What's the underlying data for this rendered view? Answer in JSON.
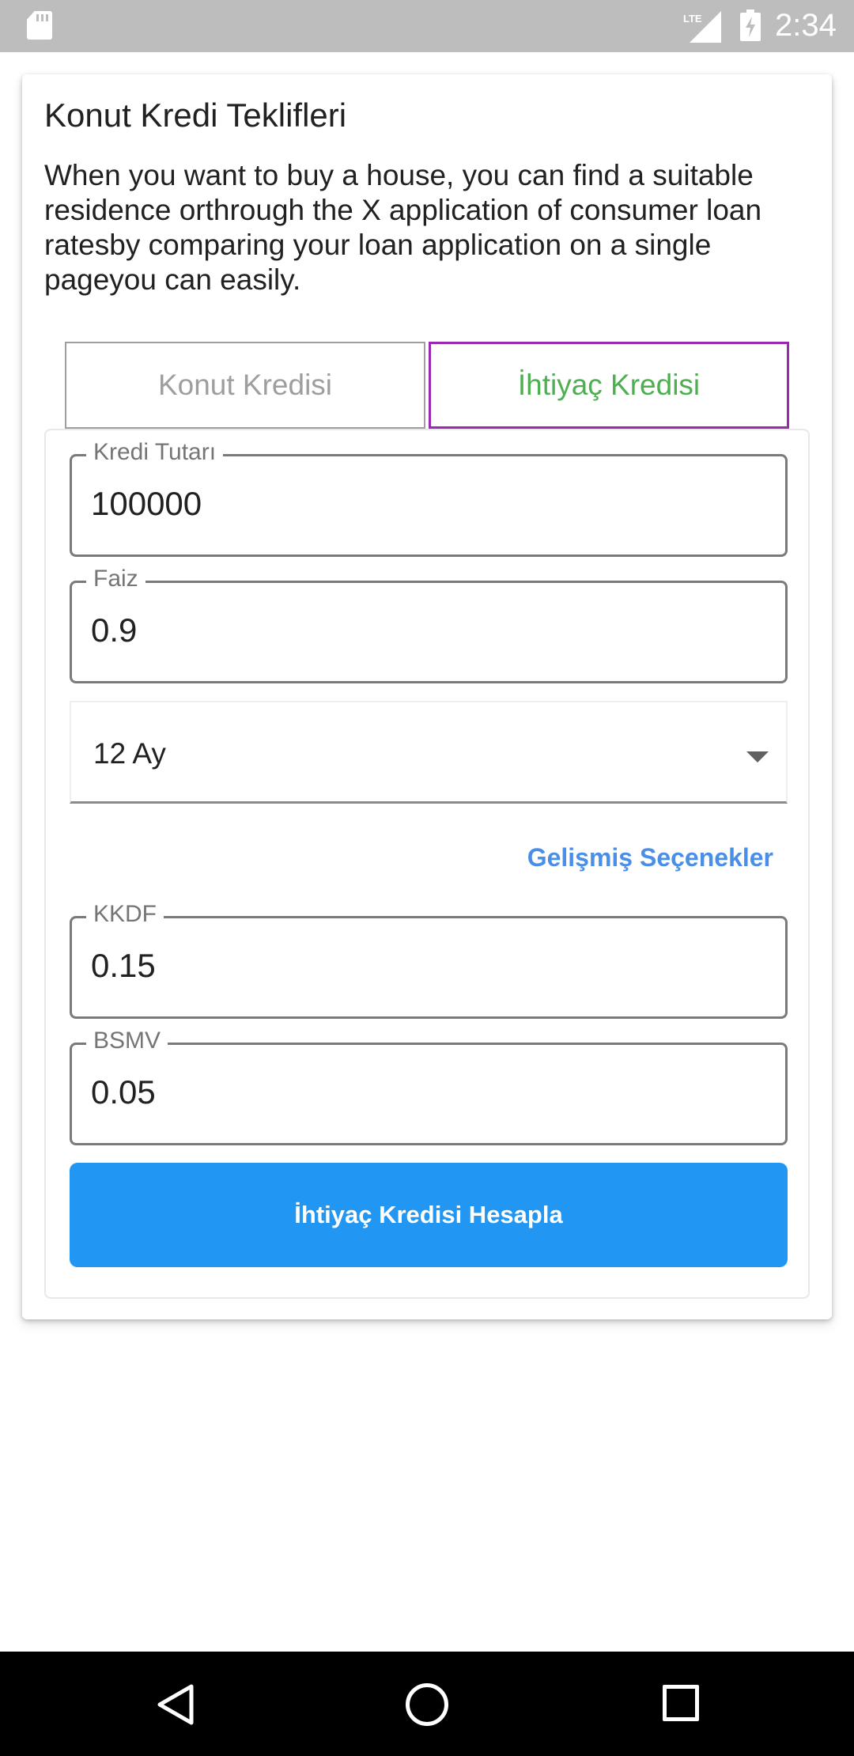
{
  "status_bar": {
    "time": "2:34",
    "network": "LTE",
    "icons": [
      "sd-card-icon",
      "lte-signal-icon",
      "battery-charging-icon"
    ]
  },
  "card": {
    "title": "Konut Kredi Teklifleri",
    "description": "When you want to buy a house, you can find a suitable residence orthrough the X application of consumer loan ratesby comparing your loan application on a single pageyou can easily."
  },
  "tabs": {
    "konut": "Konut Kredisi",
    "ihtiyac": "İhtiyaç Kredisi",
    "selected": "ihtiyac"
  },
  "form": {
    "amount": {
      "label": "Kredi Tutarı",
      "value": "100000"
    },
    "interest": {
      "label": "Faiz",
      "value": "0.9"
    },
    "term": {
      "selected": "12 Ay"
    },
    "advanced_label": "Gelişmiş Seçenekler",
    "kkdf": {
      "label": "KKDF",
      "value": "0.15"
    },
    "bsmv": {
      "label": "BSMV",
      "value": "0.05"
    },
    "submit_label": "İhtiyaç Kredisi Hesapla"
  },
  "colors": {
    "status_bar": "#bdbdbd",
    "selected_tab_border": "#9c27b0",
    "selected_tab_text": "#4caf50",
    "link": "#4a8fe7",
    "primary_button": "#2196f3",
    "nav_bar": "#000000"
  },
  "nav_bar": {
    "icons": [
      "back-icon",
      "home-icon",
      "recents-icon"
    ]
  }
}
